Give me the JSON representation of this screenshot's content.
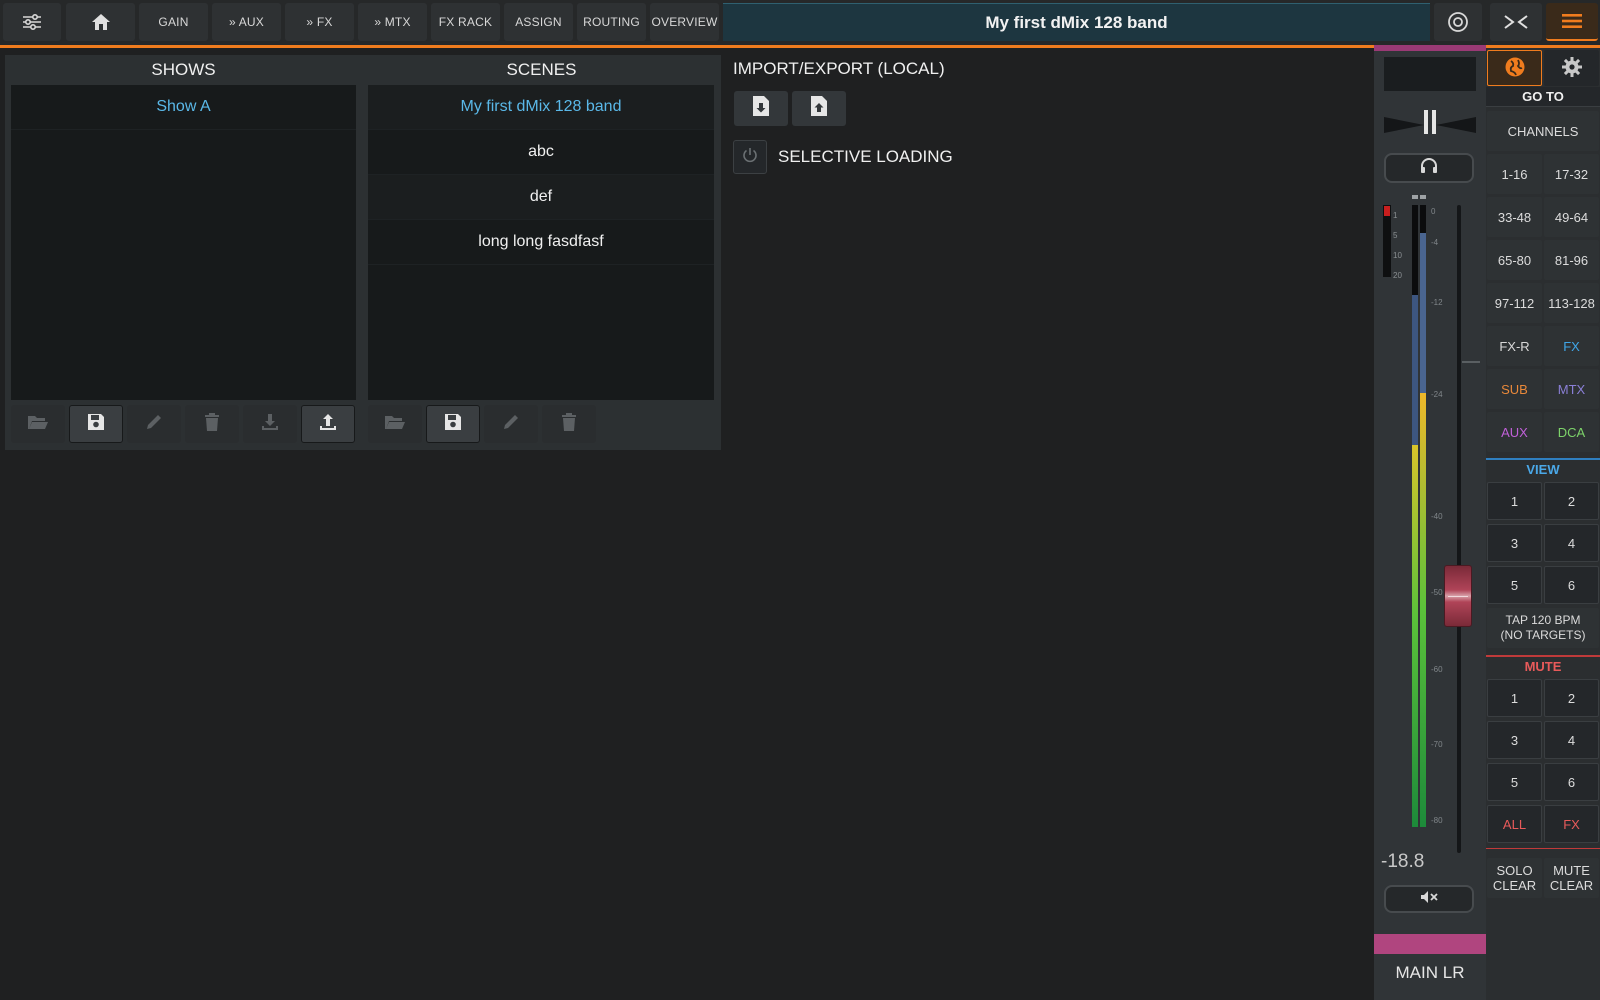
{
  "topbar": {
    "nav": [
      {
        "label": ""
      },
      {
        "label": ""
      },
      {
        "label": "GAIN"
      },
      {
        "label": "» AUX"
      },
      {
        "label": "» FX"
      },
      {
        "label": "» MTX"
      },
      {
        "label": "FX RACK"
      },
      {
        "label": "ASSIGN"
      },
      {
        "label": "ROUTING"
      },
      {
        "label": "OVERVIEW"
      }
    ],
    "title": "My first dMix 128 band"
  },
  "shows": {
    "title": "SHOWS",
    "items": [
      "Show A"
    ]
  },
  "scenes": {
    "title": "SCENES",
    "items": [
      "My first dMix 128 band",
      "abc",
      "def",
      "long long fasdfasf"
    ]
  },
  "import_export": {
    "title": "IMPORT/EXPORT (LOCAL)",
    "selective_loading": "SELECTIVE LOADING"
  },
  "strip": {
    "level": "-18.8",
    "name": "MAIN LR",
    "meter_scale": [
      "0",
      "-4",
      "-12",
      "-24",
      "-40",
      "-50",
      "-60",
      "-70",
      "-80"
    ],
    "clip_scale": [
      "1",
      "5",
      "10",
      "20"
    ],
    "accent_color": "#b0457f"
  },
  "nav": {
    "goto": "GO TO",
    "channels": "CHANNELS",
    "ranges": [
      "1-16",
      "17-32",
      "33-48",
      "49-64",
      "65-80",
      "81-96",
      "97-112",
      "113-128"
    ],
    "groups": [
      {
        "label": "FX-R",
        "color": "#d8d8d8"
      },
      {
        "label": "FX",
        "color": "#3fa6e8"
      },
      {
        "label": "SUB",
        "color": "#e8883a"
      },
      {
        "label": "MTX",
        "color": "#8a7fd6"
      },
      {
        "label": "AUX",
        "color": "#c060d8"
      },
      {
        "label": "DCA",
        "color": "#7dd36a"
      }
    ],
    "view": "VIEW",
    "view_buttons": [
      "1",
      "2",
      "3",
      "4",
      "5",
      "6"
    ],
    "tap": "TAP 120 BPM (NO TARGETS)",
    "mute": "MUTE",
    "mute_buttons": [
      "1",
      "2",
      "3",
      "4",
      "5",
      "6"
    ],
    "mute_all": "ALL",
    "mute_fx": "FX",
    "solo_clear": "SOLO CLEAR",
    "mute_clear": "MUTE CLEAR"
  }
}
